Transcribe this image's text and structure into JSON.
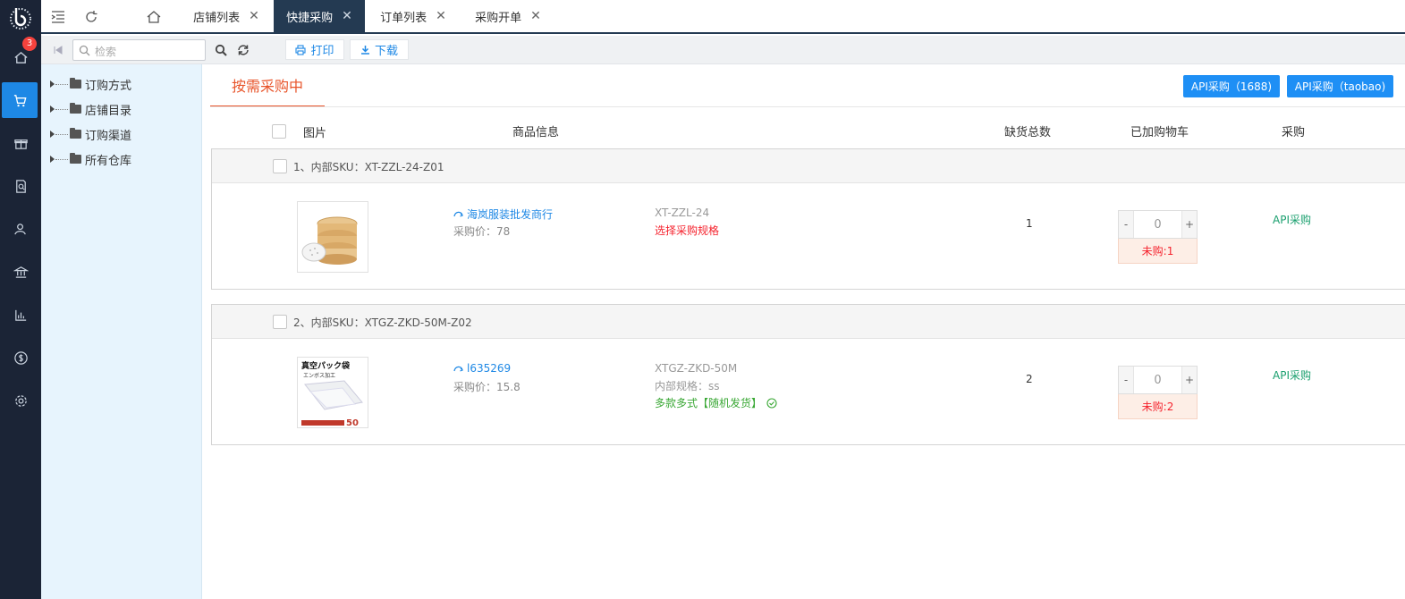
{
  "sidebar": {
    "badge": "3",
    "items": [
      {
        "icon": "home-icon"
      },
      {
        "icon": "cart-icon",
        "active": true
      },
      {
        "icon": "gift-icon"
      },
      {
        "icon": "search-document-icon"
      },
      {
        "icon": "users-icon"
      },
      {
        "icon": "bank-icon"
      },
      {
        "icon": "bar-chart-icon"
      },
      {
        "icon": "dollar-icon"
      },
      {
        "icon": "gear-icon"
      }
    ]
  },
  "tabs": [
    {
      "label": "店铺列表",
      "close": "✕"
    },
    {
      "label": "快捷采购",
      "close": "✕",
      "active": true
    },
    {
      "label": "订单列表",
      "close": "✕"
    },
    {
      "label": "采购开单",
      "close": "✕"
    }
  ],
  "toolbar": {
    "search_placeholder": "检索",
    "print_label": "打印",
    "download_label": "下载"
  },
  "tree": [
    "订购方式",
    "店铺目录",
    "订购渠道",
    "所有仓库"
  ],
  "main": {
    "subtab": "按需采购中",
    "api_1688": "API采购（1688)",
    "api_taobao": "API采购（taobao)",
    "headers": {
      "image": "图片",
      "info": "商品信息",
      "shortage": "缺货总数",
      "cart": "已加购物车",
      "purchase": "采购"
    },
    "groups": [
      {
        "label": "1、内部SKU：XT-ZZL-24-Z01",
        "shop": "海岚服装批发商行",
        "price": "采购价：78",
        "sku": "XT-ZZL-24",
        "spec": "选择采购规格",
        "qty": "1",
        "minus": "-",
        "stepper_value": "0",
        "plus": "+",
        "unbought": "未购:1",
        "api_link": "API采购"
      },
      {
        "label": "2、内部SKU：XTGZ-ZKD-50M-Z02",
        "shop": "l635269",
        "price": "采购价：15.8",
        "sku": "XTGZ-ZKD-50M",
        "spec": "内部规格：ss",
        "variant": "多款多式【随机发货】",
        "qty": "2",
        "minus": "-",
        "stepper_value": "0",
        "plus": "+",
        "unbought": "未购:2",
        "api_link": "API采购",
        "image_text_1": "真空パック袋",
        "image_text_2": "エンボス加工",
        "image_text_3": "50"
      }
    ]
  },
  "colors": {
    "sidebar_bg": "#1b2436",
    "accent": "#1e88e5",
    "active_tab": "#243a52",
    "orange": "#e8552b",
    "green": "#1a9f6e",
    "tree_bg": "#e7f4fd"
  }
}
